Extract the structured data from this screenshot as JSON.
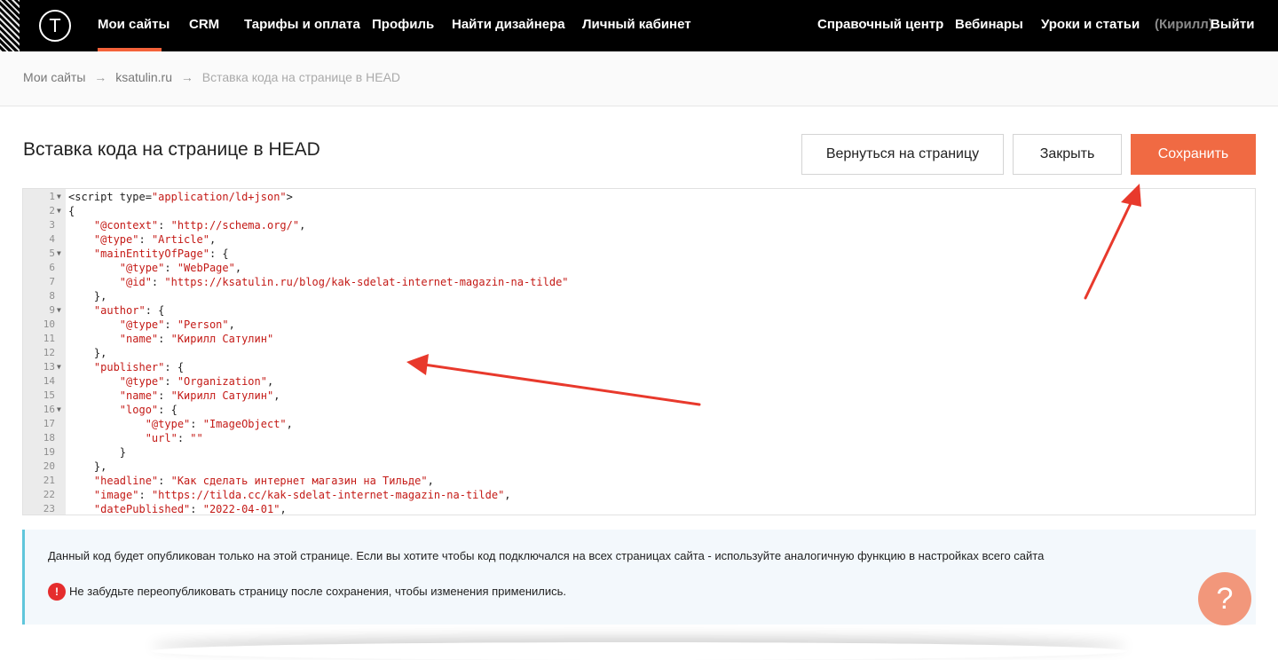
{
  "nav": {
    "items": [
      "Мои сайты",
      "CRM",
      "Тарифы и оплата",
      "Профиль",
      "Найти дизайнера",
      "Личный кабинет"
    ],
    "right_items": [
      "Справочный центр",
      "Вебинары",
      "Уроки и статьи"
    ],
    "user": "(Кирилл)",
    "logout": "Выйти",
    "logo_glyph": "T"
  },
  "breadcrumb": {
    "items": [
      "Мои сайты",
      "ksatulin.ru",
      "Вставка кода на странице в HEAD"
    ],
    "separator": "→"
  },
  "page": {
    "title": "Вставка кода на странице в HEAD",
    "back_label": "Вернуться на страницу",
    "close_label": "Закрыть",
    "save_label": "Сохранить"
  },
  "editor": {
    "lines": [
      "<script type=\"application/ld+json\">",
      "{",
      "    \"@context\": \"http://schema.org/\",",
      "    \"@type\": \"Article\",",
      "    \"mainEntityOfPage\": {",
      "        \"@type\": \"WebPage\",",
      "        \"@id\": \"https://ksatulin.ru/blog/kak-sdelat-internet-magazin-na-tilde\"",
      "    },",
      "    \"author\": {",
      "        \"@type\": \"Person\",",
      "        \"name\": \"Кирилл Сатулин\"",
      "    },",
      "    \"publisher\": {",
      "        \"@type\": \"Organization\",",
      "        \"name\": \"Кирилл Сатулин\",",
      "        \"logo\": {",
      "            \"@type\": \"ImageObject\",",
      "            \"url\": \"\"",
      "        }",
      "    },",
      "    \"headline\": \"Как сделать интернет магазин на Тильде\",",
      "    \"image\": \"https://tilda.cc/kak-sdelat-internet-magazin-na-tilde\",",
      "    \"datePublished\": \"2022-04-01\","
    ],
    "fold_lines": [
      1,
      2,
      5,
      9,
      13,
      16
    ]
  },
  "info": {
    "text": "Данный код будет опубликован только на этой странице. Если вы хотите чтобы код подключался на всех страницах сайта - используйте аналогичную функцию в настройках всего сайта",
    "warning": "Не забудьте переопубликовать страницу после сохранения, чтобы изменения применились.",
    "warning_icon": "!"
  },
  "help": {
    "glyph": "?"
  },
  "colors": {
    "accent": "#f06a43",
    "annotation": "#e8392c",
    "info_border": "#5fc6db",
    "string": "#c41a16"
  }
}
